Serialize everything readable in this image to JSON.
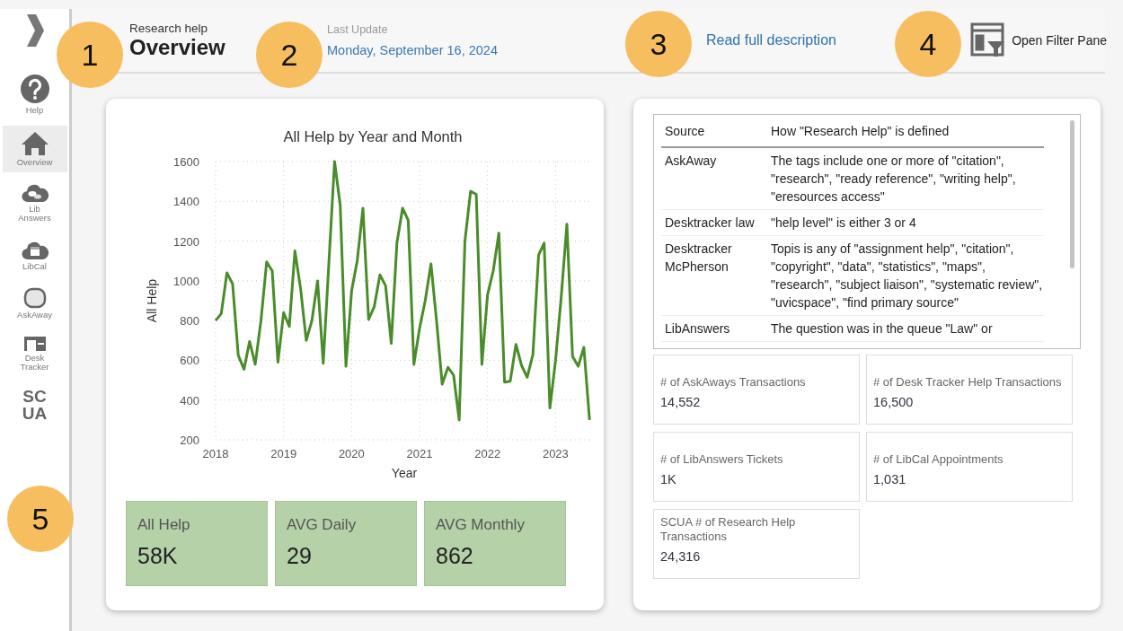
{
  "sidebar": {
    "items": [
      {
        "kind": "help",
        "label": "Help",
        "selected": false
      },
      {
        "kind": "home",
        "label": "Overview",
        "selected": true
      },
      {
        "kind": "chat",
        "label": "Lib Answers",
        "selected": false
      },
      {
        "kind": "calendar",
        "label": "LibCal",
        "selected": false
      },
      {
        "kind": "bubble",
        "label": "AskAway",
        "selected": false
      },
      {
        "kind": "desk",
        "label": "Desk Tracker",
        "selected": false
      },
      {
        "kind": "text",
        "label": "SC UA",
        "selected": false
      }
    ]
  },
  "header": {
    "subtitle": "Research help",
    "title": "Overview",
    "update_label": "Last Update",
    "update_date": "Monday, September 16, 2024",
    "link": "Read full description",
    "filter_button": "Open Filter Pane"
  },
  "annotations": [
    "1",
    "2",
    "3",
    "4",
    "5"
  ],
  "chart": {
    "chart_data": {
      "type": "line",
      "grid": true,
      "title": "All Help by Year and Month",
      "xlabel": "Year",
      "ylabel": "All Help",
      "xlim": [
        2018,
        2023.55
      ],
      "ylim": [
        200,
        1600
      ],
      "xticks": [
        2018,
        2019,
        2020,
        2021,
        2022,
        2023
      ],
      "yticks": [
        200,
        400,
        600,
        800,
        1000,
        1200,
        1400,
        1600
      ],
      "x": [
        2018,
        2018.083,
        2018.167,
        2018.25,
        2018.333,
        2018.417,
        2018.5,
        2018.583,
        2018.667,
        2018.75,
        2018.833,
        2018.917,
        2019,
        2019.083,
        2019.167,
        2019.25,
        2019.333,
        2019.417,
        2019.5,
        2019.583,
        2019.667,
        2019.75,
        2019.833,
        2019.917,
        2020,
        2020.083,
        2020.167,
        2020.25,
        2020.333,
        2020.417,
        2020.5,
        2020.583,
        2020.667,
        2020.75,
        2020.833,
        2020.917,
        2021,
        2021.083,
        2021.167,
        2021.25,
        2021.333,
        2021.417,
        2021.5,
        2021.583,
        2021.667,
        2021.75,
        2021.833,
        2021.917,
        2022,
        2022.083,
        2022.167,
        2022.25,
        2022.333,
        2022.417,
        2022.5,
        2022.583,
        2022.667,
        2022.75,
        2022.833,
        2022.917,
        2023,
        2023.083,
        2023.167,
        2023.25,
        2023.333,
        2023.417,
        2023.5
      ],
      "series": [
        {
          "color": "#4a8c2a",
          "values": [
            800,
            835,
            1040,
            985,
            625,
            555,
            695,
            580,
            800,
            1095,
            1050,
            590,
            840,
            770,
            1150,
            960,
            700,
            800,
            1000,
            585,
            1100,
            1600,
            1380,
            570,
            950,
            1100,
            1365,
            805,
            870,
            1030,
            975,
            685,
            1190,
            1365,
            1305,
            580,
            760,
            900,
            1085,
            800,
            480,
            565,
            525,
            300,
            1200,
            1450,
            1435,
            580,
            930,
            1050,
            1240,
            490,
            495,
            680,
            575,
            515,
            630,
            1130,
            1190,
            360,
            600,
            920,
            1285,
            620,
            570,
            665,
            300
          ]
        }
      ]
    }
  },
  "kpis": [
    {
      "label": "All Help",
      "value": "58K"
    },
    {
      "label": "AVG Daily",
      "value": "29"
    },
    {
      "label": "AVG Monthly",
      "value": "862"
    }
  ],
  "definitions": {
    "columns": [
      "Source",
      "How \"Research Help\" is defined"
    ],
    "rows": [
      [
        "AskAway",
        "The tags include one or more of \"citation\", \"research\", \"ready reference\", \"writing help\", \"eresources access\""
      ],
      [
        "Desktracker law",
        "\"help level\" is either 3 or 4"
      ],
      [
        "Desktracker McPherson",
        "Topis is any of \"assignment help\", \"citation\", \"copyright\", \"data\", \"statistics\", \"maps\", \"research\", \"subject liaison\", \"systematic review\", \"uvicspace\", \"find primary source\""
      ],
      [
        "LibAnswers",
        "The question was in the queue \"Law\" or"
      ]
    ]
  },
  "metrics": [
    {
      "label": "# of AskAways Transactions",
      "value": "14,552"
    },
    {
      "label": "# of Desk Tracker Help Transactions",
      "value": "16,500"
    },
    {
      "label": "# of LibAnswers Tickets",
      "value": "1K"
    },
    {
      "label": "# of LibCal Appointments",
      "value": "1,031"
    },
    {
      "label": "SCUA # of Research Help Transactions",
      "value": "24,316"
    }
  ]
}
